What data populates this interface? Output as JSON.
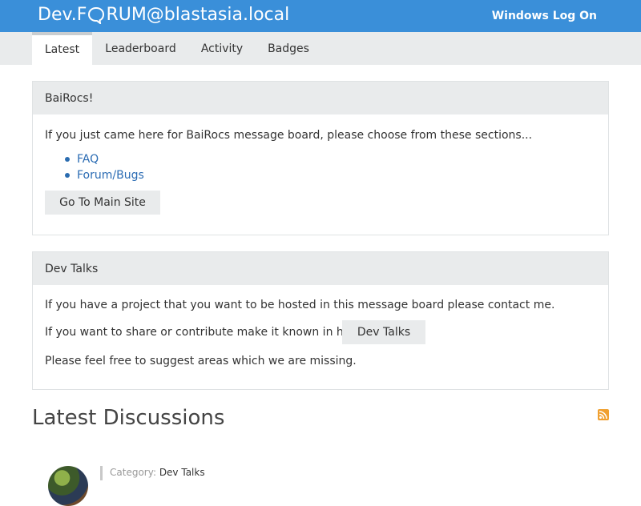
{
  "header": {
    "brand_prefix": "Dev.F",
    "brand_suffix": "RUM@blastasia.local",
    "logon": "Windows Log On",
    "color": "#3a8fd9"
  },
  "tabs": [
    {
      "label": "Latest",
      "active": true
    },
    {
      "label": "Leaderboard",
      "active": false
    },
    {
      "label": "Activity",
      "active": false
    },
    {
      "label": "Badges",
      "active": false
    }
  ],
  "panel_bairocs": {
    "title": "BaiRocs!",
    "intro": "If you just came here for BaiRocs message board, please choose from these sections...",
    "links": [
      "FAQ",
      "Forum/Bugs"
    ],
    "button": "Go To Main Site"
  },
  "panel_devtalks": {
    "title": "Dev Talks",
    "line1": "If you have a project that you want to be hosted in this message board please contact me.",
    "line2": "If you want to share or contribute make it known in here",
    "button": "Dev Talks",
    "line3": "Please feel free to suggest areas which we are missing."
  },
  "latest": {
    "title": "Latest Discussions",
    "rss_icon": "rss-icon",
    "category_label": "Category:",
    "category_value": "Dev Talks"
  }
}
